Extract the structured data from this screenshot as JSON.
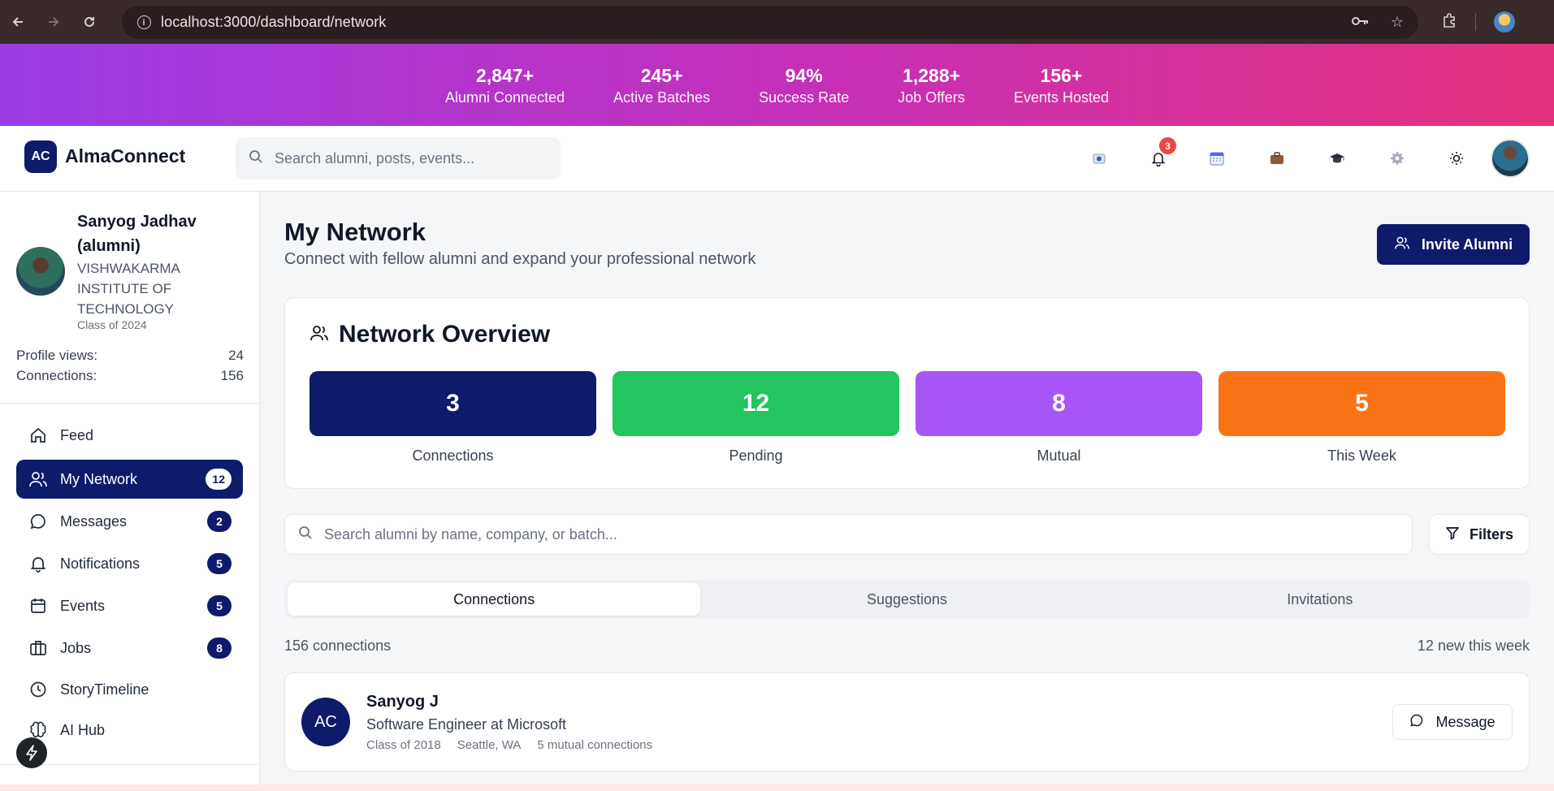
{
  "browser": {
    "url": "localhost:3000/dashboard/network"
  },
  "banner": {
    "stats": [
      {
        "value": "2,847+",
        "label": "Alumni Connected"
      },
      {
        "value": "245+",
        "label": "Active Batches"
      },
      {
        "value": "94%",
        "label": "Success Rate"
      },
      {
        "value": "1,288+",
        "label": "Job Offers"
      },
      {
        "value": "156+",
        "label": "Events Hosted"
      }
    ]
  },
  "header": {
    "logo_initials": "AC",
    "app_name": "AlmaConnect",
    "search_placeholder": "Search alumni, posts, events...",
    "notification_count": "3"
  },
  "sidebar": {
    "profile": {
      "name": "Sanyog Jadhav (alumni)",
      "school": "VISHWAKARMA INSTITUTE OF TECHNOLOGY",
      "class_of": "Class of 2024",
      "profile_views_label": "Profile views:",
      "profile_views": "24",
      "connections_label": "Connections:",
      "connections": "156"
    },
    "menu": [
      {
        "label": "Feed",
        "icon": "home-icon",
        "badge": ""
      },
      {
        "label": "My Network",
        "icon": "users-icon",
        "badge": "12",
        "active": true
      },
      {
        "label": "Messages",
        "icon": "message-icon",
        "badge": "2"
      },
      {
        "label": "Notifications",
        "icon": "bell-icon",
        "badge": "5"
      },
      {
        "label": "Events",
        "icon": "calendar-icon",
        "badge": "5"
      },
      {
        "label": "Jobs",
        "icon": "briefcase-icon",
        "badge": "8"
      },
      {
        "label": "StoryTimeline",
        "icon": "clock-icon",
        "badge": ""
      },
      {
        "label": "AI Hub",
        "icon": "brain-icon",
        "badge": ""
      }
    ]
  },
  "main": {
    "title": "My Network",
    "subtitle": "Connect with fellow alumni and expand your professional network",
    "invite_label": "Invite Alumni",
    "overview": {
      "title": "Network Overview",
      "cards": [
        {
          "value": "3",
          "label": "Connections",
          "color": "#0e1b6b"
        },
        {
          "value": "12",
          "label": "Pending",
          "color": "#22c55e"
        },
        {
          "value": "8",
          "label": "Mutual",
          "color": "#a855f7"
        },
        {
          "value": "5",
          "label": "This Week",
          "color": "#f97316"
        }
      ]
    },
    "search_placeholder": "Search alumni by name, company, or batch...",
    "filters_label": "Filters",
    "tabs": [
      "Connections",
      "Suggestions",
      "Invitations"
    ],
    "active_tab": "Connections",
    "count_text": "156 connections",
    "new_text": "12 new this week",
    "connections": [
      {
        "initials": "AC",
        "name": "Sanyog J",
        "title": "Software Engineer at Microsoft",
        "class_of": "Class of 2018",
        "location": "Seattle, WA",
        "mutual": "5 mutual connections",
        "message_label": "Message"
      }
    ]
  }
}
